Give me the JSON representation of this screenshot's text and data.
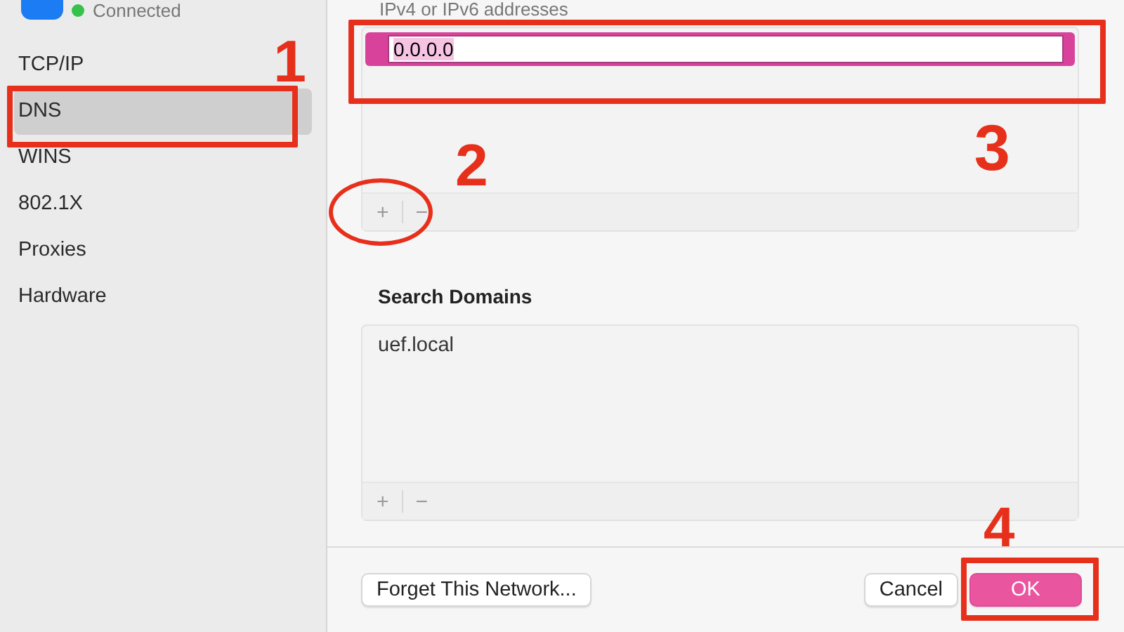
{
  "status": {
    "label": "Connected",
    "connected": true
  },
  "sidebar": {
    "items": [
      {
        "label": "TCP/IP",
        "selected": false
      },
      {
        "label": "DNS",
        "selected": true,
        "callout": {
          "number": "1",
          "kind": "frame"
        }
      },
      {
        "label": "WINS",
        "selected": false
      },
      {
        "label": "802.1X",
        "selected": false
      },
      {
        "label": "Proxies",
        "selected": false
      },
      {
        "label": "Hardware",
        "selected": false
      }
    ]
  },
  "dns_servers": {
    "caption": "IPv4 or IPv6 addresses",
    "field": {
      "value": "0.0.0.0",
      "text_selected": true,
      "callout": {
        "number": "3",
        "kind": "frame"
      }
    },
    "add": {
      "label": "+",
      "callout": {
        "number": "2",
        "kind": "circle"
      }
    },
    "remove": {
      "label": "−"
    }
  },
  "search_domains": {
    "title": "Search Domains",
    "items": [
      "uef.local"
    ],
    "add": {
      "label": "+"
    },
    "remove": {
      "label": "−"
    }
  },
  "footer": {
    "forget": "Forget This Network...",
    "cancel": "Cancel",
    "ok": {
      "label": "OK",
      "callout": {
        "number": "4",
        "kind": "frame"
      }
    }
  }
}
